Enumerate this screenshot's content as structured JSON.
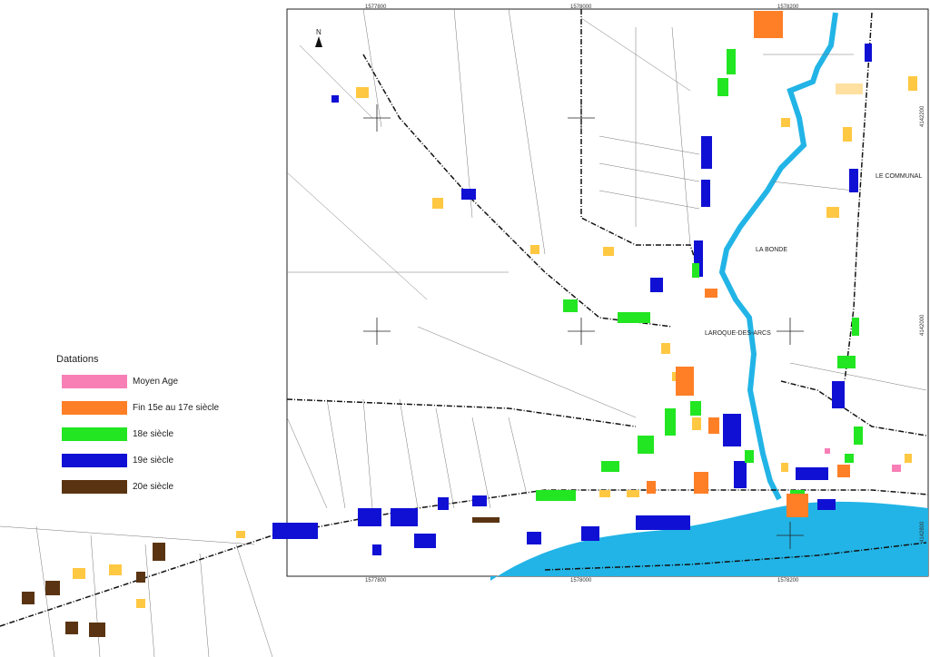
{
  "legend": {
    "title": "Datations",
    "items": [
      {
        "label": "Moyen Age",
        "color": "#f77fb6"
      },
      {
        "label": "Fin 15e au 17e siècle",
        "color": "#ff7f27"
      },
      {
        "label": "18e siècle",
        "color": "#22e622"
      },
      {
        "label": "19e siècle",
        "color": "#1010d4"
      },
      {
        "label": "20e siècle",
        "color": "#5a3412"
      }
    ]
  },
  "other_building_color": "#ffc843",
  "water_color": "#22b4e6",
  "place_names": {
    "village": "LAROQUE-DES-ARCS",
    "bonde": "LA BONDE",
    "communal": "LE COMMUNAL"
  },
  "coords": {
    "top": [
      "1577800",
      "1578000",
      "1578200"
    ],
    "bottom": [
      "1577800",
      "1578000",
      "1578200"
    ],
    "right": [
      "4142200",
      "4142000",
      "4142800"
    ]
  },
  "north_arrow": "N"
}
